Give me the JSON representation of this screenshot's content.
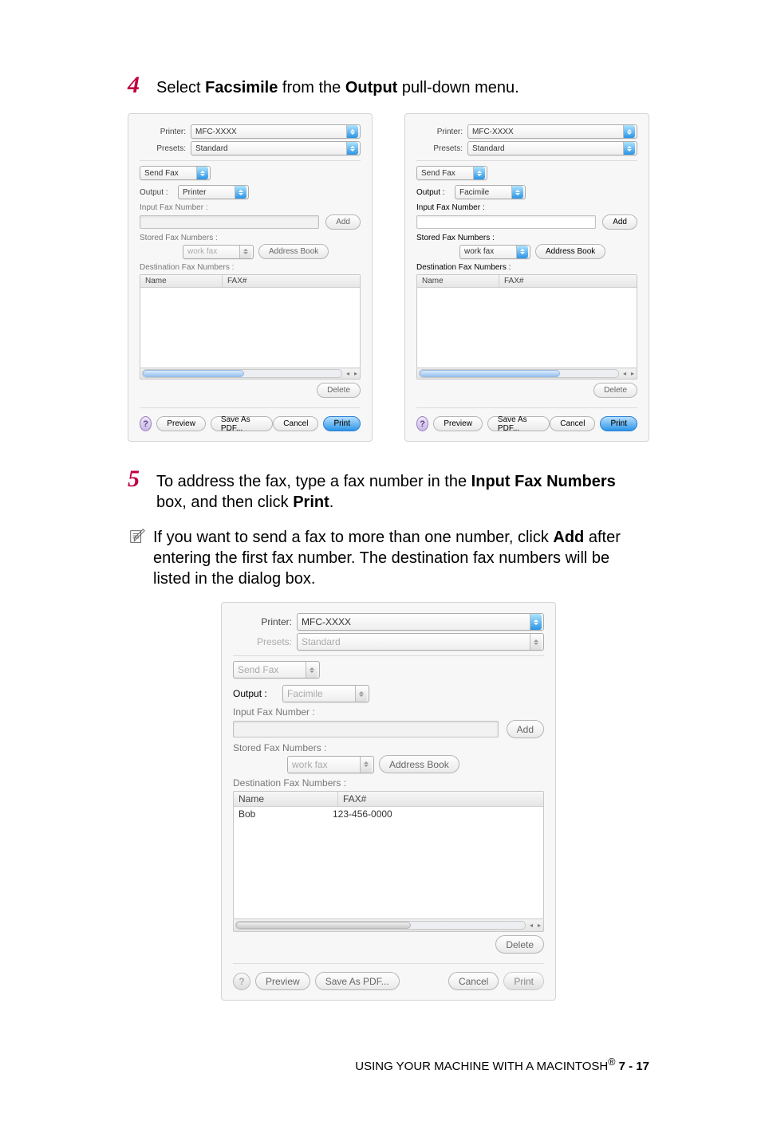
{
  "step4": {
    "num": "4",
    "text_pre": "Select ",
    "bold1": "Facsimile",
    "text_mid": " from the ",
    "bold2": "Output",
    "text_post": " pull-down menu."
  },
  "step5": {
    "num": "5",
    "text_pre": "To address the fax, type a fax number in the ",
    "bold1": "Input Fax Numbers",
    "text_mid": " box, and then click ",
    "bold2": "Print",
    "text_post": "."
  },
  "note": {
    "text_pre": "If you want to send a fax to more than one number, click ",
    "bold1": "Add",
    "text_post": " after entering the first fax number. The destination fax numbers will be listed in the dialog box."
  },
  "dialog_left": {
    "printer_label": "Printer:",
    "printer_value": "MFC-XXXX",
    "presets_label": "Presets:",
    "presets_value": "Standard",
    "tab_value": "Send Fax",
    "output_label": "Output :",
    "output_value": "Printer",
    "input_label": "Input Fax Number :",
    "add_btn": "Add",
    "stored_label": "Stored Fax Numbers :",
    "stored_select": "work fax",
    "address_book_btn": "Address Book",
    "dest_label": "Destination Fax Numbers :",
    "col_name": "Name",
    "col_fax": "FAX#",
    "delete_btn": "Delete",
    "preview_btn": "Preview",
    "save_pdf_btn": "Save As PDF...",
    "cancel_btn": "Cancel",
    "print_btn": "Print"
  },
  "dialog_right": {
    "printer_label": "Printer:",
    "printer_value": "MFC-XXXX",
    "presets_label": "Presets:",
    "presets_value": "Standard",
    "tab_value": "Send Fax",
    "output_label": "Output :",
    "output_value": "Facimile",
    "input_label": "Input Fax Number :",
    "add_btn": "Add",
    "stored_label": "Stored Fax Numbers :",
    "stored_select": "work fax",
    "address_book_btn": "Address Book",
    "dest_label": "Destination Fax Numbers :",
    "col_name": "Name",
    "col_fax": "FAX#",
    "delete_btn": "Delete",
    "preview_btn": "Preview",
    "save_pdf_btn": "Save As PDF...",
    "cancel_btn": "Cancel",
    "print_btn": "Print"
  },
  "dialog_bottom": {
    "printer_label": "Printer:",
    "printer_value": "MFC-XXXX",
    "presets_label": "Presets:",
    "presets_value": "Standard",
    "tab_value": "Send Fax",
    "output_label": "Output :",
    "output_value": "Facimile",
    "input_label": "Input Fax Number :",
    "add_btn": "Add",
    "stored_label": "Stored Fax Numbers :",
    "stored_select": "work fax",
    "address_book_btn": "Address Book",
    "dest_label": "Destination Fax Numbers :",
    "col_name": "Name",
    "col_fax": "FAX#",
    "row_name": "Bob",
    "row_fax": "123-456-0000",
    "delete_btn": "Delete",
    "preview_btn": "Preview",
    "save_pdf_btn": "Save As PDF...",
    "cancel_btn": "Cancel",
    "print_btn": "Print"
  },
  "footer": {
    "text": "USING YOUR MACHINE WITH A MACINTOSH",
    "reg": "®",
    "page": "   7 - 17"
  }
}
